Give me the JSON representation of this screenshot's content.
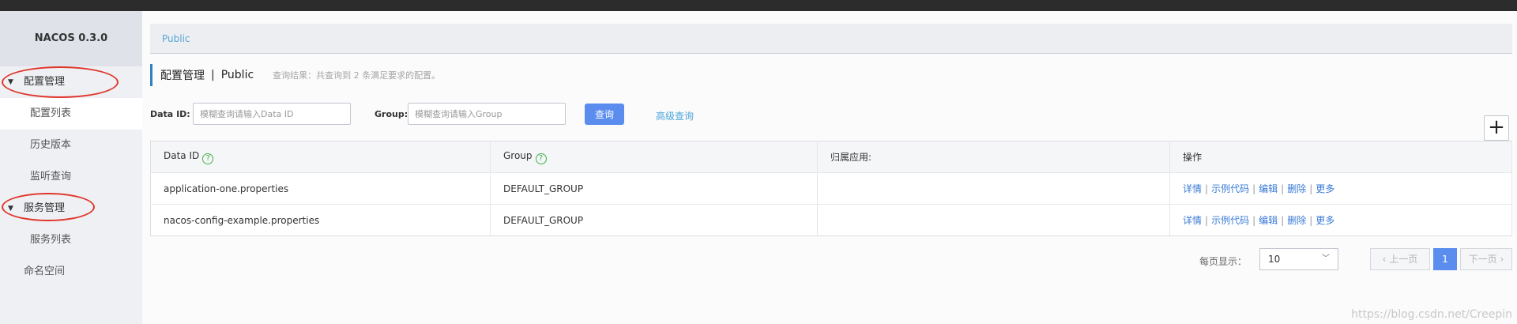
{
  "app": {
    "title": "NACOS 0.3.0"
  },
  "sidebar": {
    "groups": [
      {
        "label": "配置管理",
        "items": [
          {
            "label": "配置列表"
          },
          {
            "label": "历史版本"
          },
          {
            "label": "监听查询"
          }
        ]
      },
      {
        "label": "服务管理",
        "items": [
          {
            "label": "服务列表"
          }
        ]
      }
    ],
    "namespace": "命名空间"
  },
  "breadcrumb": "Public",
  "page": {
    "title": "配置管理",
    "separator": "|",
    "namespace": "Public",
    "result": "查询结果：共查询到 2 条满足要求的配置。"
  },
  "search": {
    "data_id_label": "Data ID:",
    "data_id_placeholder": "模糊查询请输入Data ID",
    "group_label": "Group:",
    "group_placeholder": "模糊查询请输入Group",
    "query_button": "查询",
    "advanced_link": "高级查询",
    "add_button": "+"
  },
  "table": {
    "columns": [
      "Data ID",
      "Group",
      "归属应用:",
      "操作"
    ],
    "help_glyph": "?",
    "rows": [
      {
        "data_id": "application-one.properties",
        "group": "DEFAULT_GROUP",
        "app": ""
      },
      {
        "data_id": "nacos-config-example.properties",
        "group": "DEFAULT_GROUP",
        "app": ""
      }
    ],
    "actions": [
      "详情",
      "示例代码",
      "编辑",
      "删除",
      "更多"
    ],
    "action_separator": "|"
  },
  "pagination": {
    "per_page_label": "每页显示：",
    "per_page_value": "10",
    "prev": "上一页",
    "current_page": "1",
    "next": "下一页"
  },
  "watermark": "https://blog.csdn.net/Creepin",
  "colors": {
    "primary": "#5b8def",
    "link": "#3a7bd5",
    "accent_bar": "#2d82c3",
    "help_green": "#3fb24a",
    "annotation_red": "#e0352b"
  }
}
